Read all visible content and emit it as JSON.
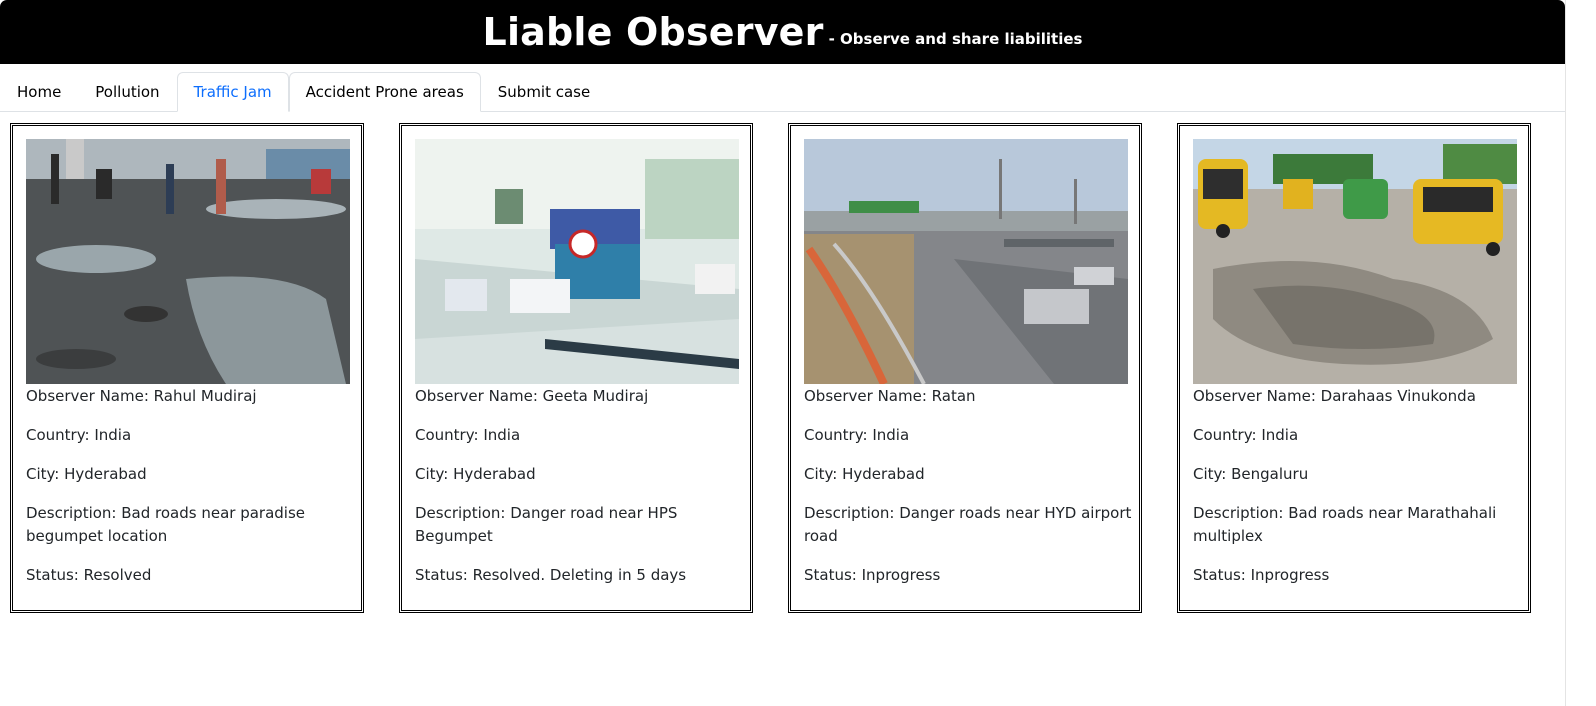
{
  "header": {
    "title": "Liable Observer",
    "tagline": "- Observe and share liabilities"
  },
  "nav": {
    "tabs": [
      {
        "label": "Home"
      },
      {
        "label": "Pollution"
      },
      {
        "label": "Traffic Jam"
      },
      {
        "label": "Accident Prone areas"
      },
      {
        "label": "Submit case"
      }
    ]
  },
  "cards": [
    {
      "observer": "Observer Name: Rahul Mudiraj",
      "country": "Country: India",
      "city": "City: Hyderabad",
      "description": "Description: Bad roads near paradise begumpet location",
      "status": "Status: Resolved"
    },
    {
      "observer": "Observer Name: Geeta Mudiraj",
      "country": "Country: India",
      "city": "City: Hyderabad",
      "description": "Description: Danger road near HPS Begumpet",
      "status": "Status: Resolved. Deleting in 5 days"
    },
    {
      "observer": "Observer Name: Ratan",
      "country": "Country: India",
      "city": "City: Hyderabad",
      "description": "Description: Danger roads near HYD airport road",
      "status": "Status: Inprogress"
    },
    {
      "observer": "Observer Name: Darahaas Vinukonda",
      "country": "Country: India",
      "city": "City: Bengaluru",
      "description": "Description: Bad roads near Marathahali multiplex",
      "status": "Status: Inprogress"
    }
  ]
}
